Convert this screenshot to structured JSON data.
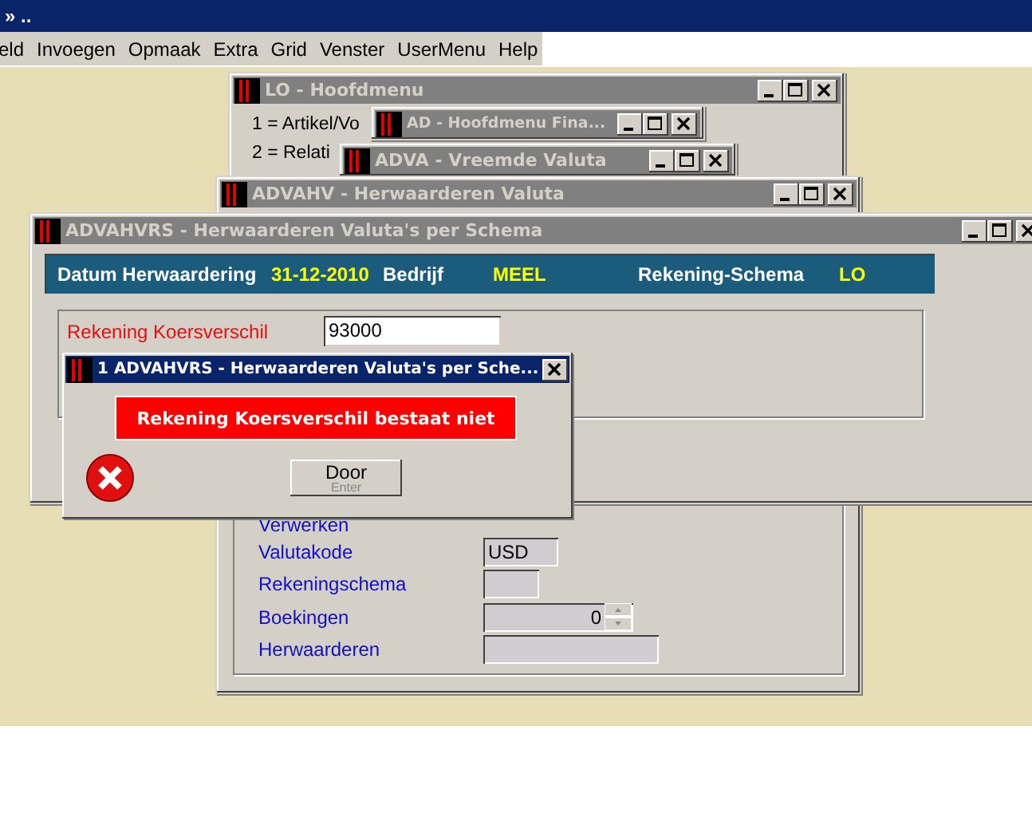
{
  "app": {
    "title": "» .."
  },
  "menu": [
    "eld",
    "Invoegen",
    "Opmaak",
    "Extra",
    "Grid",
    "Venster",
    "UserMenu",
    "Help"
  ],
  "main_menu_window": {
    "title": "LO - Hoofdmenu",
    "lines": [
      "1 = Artikel/Vo",
      "2 = Relati"
    ]
  },
  "finance_window": {
    "title": "AD - Hoofdmenu Fina..."
  },
  "currency_window": {
    "title": "ADVA - Vreemde Valuta"
  },
  "revaluation_window": {
    "title": "ADVAHV - Herwaarderen Valuta",
    "fields": [
      {
        "label": "Verwerken",
        "kind": "none"
      },
      {
        "label": "Valutakode",
        "kind": "short",
        "value": "USD"
      },
      {
        "label": "Rekeningschema",
        "kind": "narrow"
      },
      {
        "label": "Boekingen",
        "kind": "spin",
        "value": "0"
      },
      {
        "label": "Herwaarderen",
        "kind": "wide"
      }
    ]
  },
  "schema_window": {
    "title": "ADVAHVRS - Herwaarderen Valuta's per Schema",
    "header": [
      {
        "text": "Datum Herwaardering",
        "kind": "label"
      },
      {
        "text": "31-12-2010",
        "kind": "value"
      },
      {
        "text": "Bedrijf",
        "kind": "label"
      },
      {
        "text": "MEEL",
        "kind": "value"
      },
      {
        "text": "Rekening-Schema",
        "kind": "label"
      },
      {
        "text": "LO",
        "kind": "value"
      }
    ],
    "account_label": "Rekening Koersverschil",
    "account_value": "93000"
  },
  "dialog": {
    "title": "1 ADVAHVRS - Herwaarderen Valuta's per Sche...",
    "message": "Rekening Koersverschil bestaat niet",
    "button": "Door",
    "button_hint": "Enter"
  }
}
